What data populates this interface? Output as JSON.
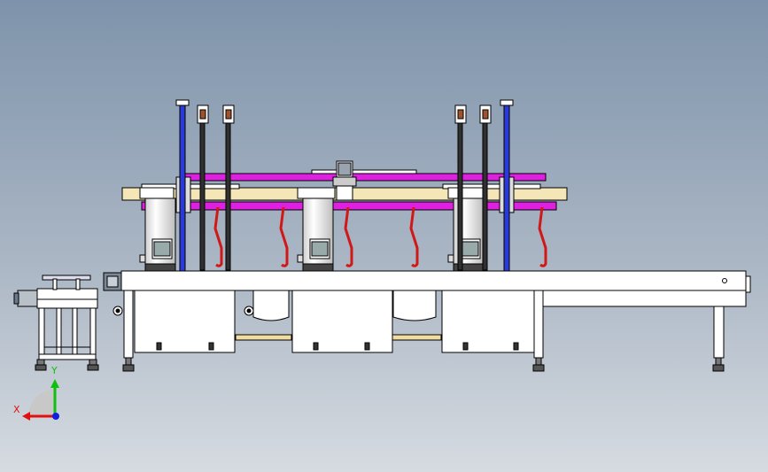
{
  "triad": {
    "x_label": "X",
    "y_label": "Y",
    "x_color": "#e01010",
    "y_color": "#10c010",
    "z_color": "#1020e0"
  },
  "colors": {
    "frame": "#ffffff",
    "outline": "#000000",
    "rail_magenta": "#e020e0",
    "beam_tan": "#f5e6b8",
    "post_blue": "#2a3ad8",
    "hook_red": "#d01818",
    "chain": "#303030",
    "shaft": "#f0dca0"
  },
  "icons": [
    "coordinate-triad-icon"
  ]
}
